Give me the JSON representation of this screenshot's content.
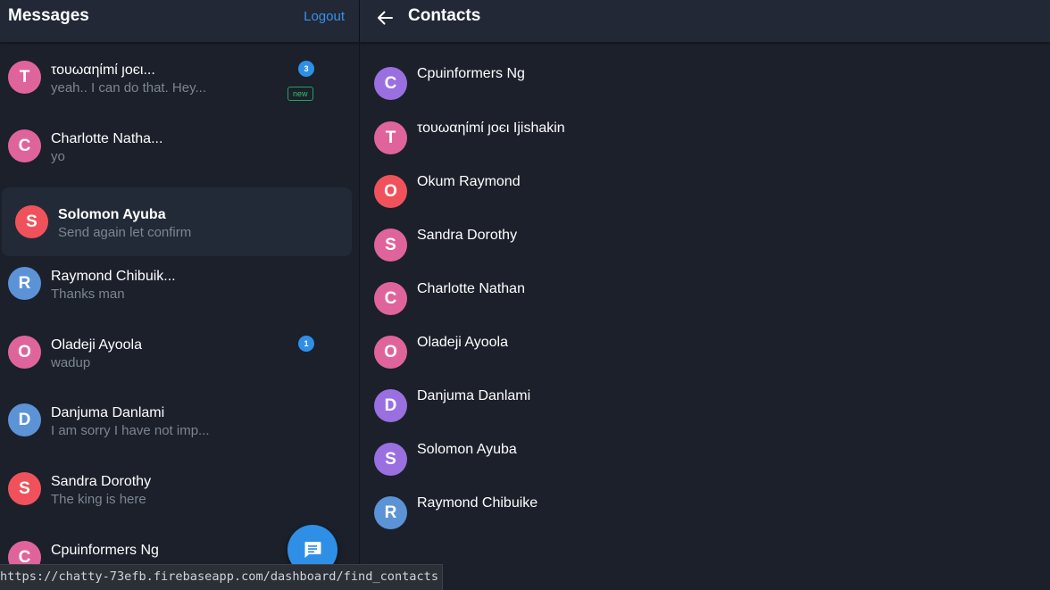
{
  "left_header": {
    "title": "Messages",
    "logout_label": "Logout"
  },
  "conversations": [
    {
      "initial": "T",
      "name": "τουωαηίmί ȷοєι...",
      "preview": "yeah.. I can do that. Hey...",
      "color": "#e0649c",
      "unread": "3"
    },
    {
      "initial": "C",
      "name": "Charlotte Natha...",
      "preview": "yo",
      "color": "#e0649c",
      "badge": "new"
    },
    {
      "initial": "S",
      "name": "Solomon Ayuba",
      "preview": "Send again let confirm",
      "color": "#f0525c",
      "active": true
    },
    {
      "initial": "R",
      "name": "Raymond Chibuik...",
      "preview": "Thanks man",
      "color": "#5b93d6"
    },
    {
      "initial": "O",
      "name": "Oladeji Ayoola",
      "preview": "wadup",
      "color": "#e0649c",
      "unread": "1"
    },
    {
      "initial": "D",
      "name": "Danjuma Danlami",
      "preview": "I am sorry I have not imp...",
      "color": "#5b93d6"
    },
    {
      "initial": "S",
      "name": "Sandra Dorothy",
      "preview": "The king is here",
      "color": "#f0525c"
    },
    {
      "initial": "C",
      "name": "Cpuinformers Ng",
      "preview": "",
      "color": "#e0649c"
    }
  ],
  "fab": {
    "icon": "chat-icon"
  },
  "right_header": {
    "title": "Contacts",
    "back_icon": "arrow-left-icon"
  },
  "contacts": [
    {
      "initial": "C",
      "name": "Cpuinformers Ng",
      "color": "#9a6fe0"
    },
    {
      "initial": "T",
      "name": "τουωαηίmί ȷοєι Ijishakin",
      "color": "#e0649c"
    },
    {
      "initial": "O",
      "name": "Okum Raymond",
      "color": "#f0525c"
    },
    {
      "initial": "S",
      "name": "Sandra Dorothy",
      "color": "#e0649c"
    },
    {
      "initial": "C",
      "name": "Charlotte Nathan",
      "color": "#e0649c"
    },
    {
      "initial": "O",
      "name": "Oladeji Ayoola",
      "color": "#e0649c"
    },
    {
      "initial": "D",
      "name": "Danjuma Danlami",
      "color": "#9a6fe0"
    },
    {
      "initial": "S",
      "name": "Solomon Ayuba",
      "color": "#9a6fe0"
    },
    {
      "initial": "R",
      "name": "Raymond Chibuike",
      "color": "#5b93d6"
    }
  ],
  "status_url": "https://chatty-73efb.firebaseapp.com/dashboard/find_contacts"
}
